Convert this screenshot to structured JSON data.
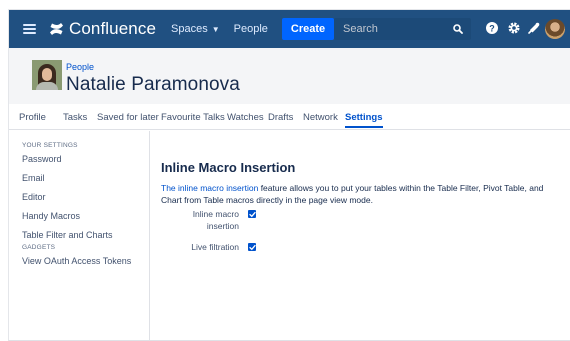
{
  "topnav": {
    "logo_text": "Confluence",
    "spaces_label": "Spaces",
    "people_label": "People",
    "create_label": "Create",
    "more_label": "···",
    "search_placeholder": "Search"
  },
  "profile": {
    "breadcrumb": "People",
    "name": "Natalie Paramonova"
  },
  "tabs": [
    {
      "label": "Profile"
    },
    {
      "label": "Tasks"
    },
    {
      "label": "Saved for later"
    },
    {
      "label": "Favourite Talks"
    },
    {
      "label": "Watches"
    },
    {
      "label": "Drafts"
    },
    {
      "label": "Network"
    },
    {
      "label": "Settings",
      "active": true
    }
  ],
  "sidebar": {
    "heading_settings": "YOUR SETTINGS",
    "settings_items": [
      "Password",
      "Email",
      "Editor",
      "Handy Macros",
      "Table Filter and Charts"
    ],
    "heading_gadgets": "GADGETS",
    "gadget_items": [
      "View OAuth Access Tokens"
    ]
  },
  "main": {
    "title": "Inline Macro Insertion",
    "desc_link": "The inline macro insertion",
    "desc_rest": " feature allows you to put your tables within the Table Filter, Pivot Table, and Chart from Table macros directly in the page view mode.",
    "options": [
      {
        "label": "Inline macro insertion",
        "checked": true
      },
      {
        "label": "Live filtration",
        "checked": true
      }
    ]
  },
  "colors": {
    "nav_bg": "#205081",
    "accent": "#0052cc",
    "create_btn": "#0065ff"
  }
}
